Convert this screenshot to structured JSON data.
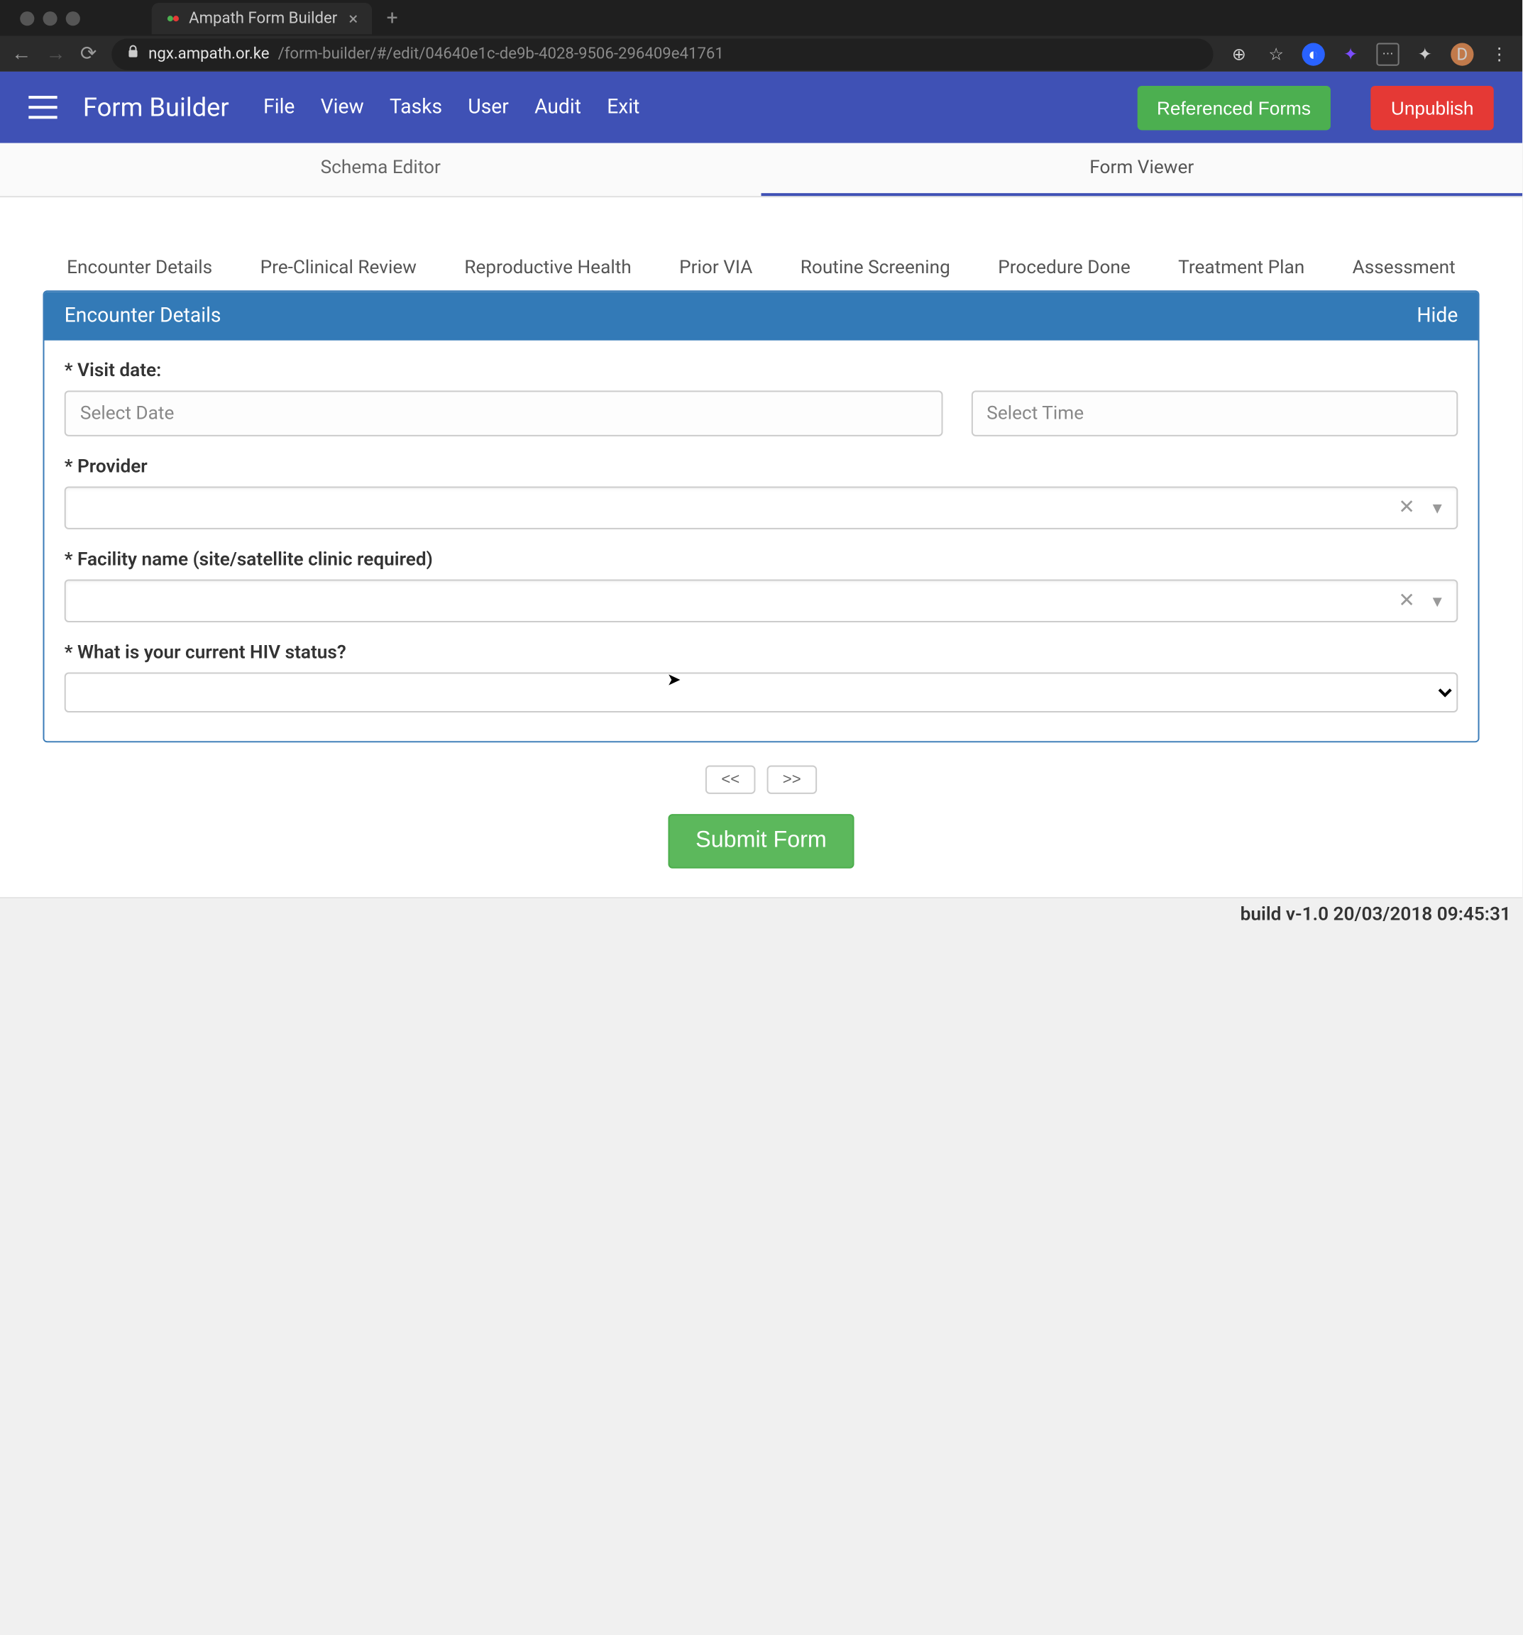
{
  "browser": {
    "tab_title": "Ampath Form Builder",
    "url_host": "ngx.ampath.or.ke",
    "url_path": "/form-builder/#/edit/04640e1c-de9b-4028-9506-296409e41761",
    "avatar_initial": "D"
  },
  "app": {
    "title": "Form Builder",
    "menu": [
      "File",
      "View",
      "Tasks",
      "User",
      "Audit",
      "Exit"
    ],
    "btn_referenced": "Referenced Forms",
    "btn_unpublish": "Unpublish"
  },
  "sub_tabs": {
    "schema": "Schema Editor",
    "viewer": "Form Viewer"
  },
  "section_tabs": [
    "Encounter Details",
    "Pre-Clinical Review",
    "Reproductive Health",
    "Prior VIA",
    "Routine Screening",
    "Procedure Done",
    "Treatment Plan",
    "Assessment"
  ],
  "panel": {
    "title": "Encounter Details",
    "hide": "Hide"
  },
  "form": {
    "visit_date_label": "* Visit date:",
    "date_placeholder": "Select Date",
    "time_placeholder": "Select Time",
    "provider_label": "* Provider",
    "facility_label": "* Facility name (site/satellite clinic required)",
    "hiv_label": "* What is your current HIV status?"
  },
  "pager": {
    "prev": "<<",
    "next": ">>"
  },
  "submit_label": "Submit Form",
  "build_info": "build v-1.0 20/03/2018 09:45:31"
}
